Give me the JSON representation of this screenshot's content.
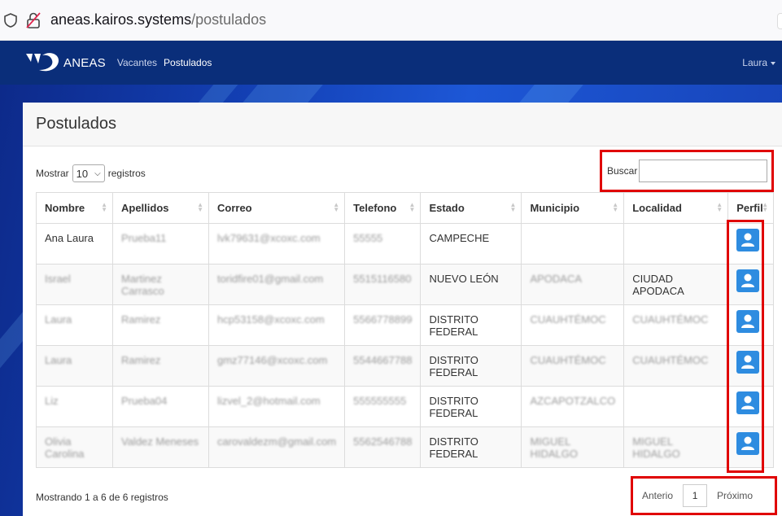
{
  "browser": {
    "url_host": "aneas.kairos.systems",
    "url_path": "/postulados"
  },
  "navbar": {
    "brand": "ANEAS",
    "links": [
      "Vacantes",
      "Postulados"
    ],
    "user": "Laura"
  },
  "card": {
    "title": "Postulados",
    "length_prefix": "Mostrar",
    "length_value": "10",
    "length_suffix": "registros",
    "search_label": "Buscar",
    "columns": [
      "Nombre",
      "Apellidos",
      "Correo",
      "Telefono",
      "Estado",
      "Municipio",
      "Localidad",
      "Perfil"
    ],
    "rows": [
      {
        "nombre": "Ana Laura",
        "apellidos": "Prueba11",
        "correo": "lvk79631@xcoxc.com",
        "telefono": "55555",
        "estado": "CAMPECHE",
        "municipio": "",
        "localidad": ""
      },
      {
        "nombre": "Israel",
        "apellidos": "Martinez Carrasco",
        "correo": "toridfire01@gmail.com",
        "telefono": "5515116580",
        "estado": "NUEVO LEÓN",
        "municipio": "APODACA",
        "localidad": "CIUDAD APODACA"
      },
      {
        "nombre": "Laura",
        "apellidos": "Ramirez",
        "correo": "hcp53158@xcoxc.com",
        "telefono": "5566778899",
        "estado": "DISTRITO FEDERAL",
        "municipio": "CUAUHTÉMOC",
        "localidad": "CUAUHTÉMOC"
      },
      {
        "nombre": "Laura",
        "apellidos": "Ramirez",
        "correo": "gmz77146@xcoxc.com",
        "telefono": "5544667788",
        "estado": "DISTRITO FEDERAL",
        "municipio": "CUAUHTÉMOC",
        "localidad": "CUAUHTÉMOC"
      },
      {
        "nombre": "Liz",
        "apellidos": "Prueba04",
        "correo": "lizvel_2@hotmail.com",
        "telefono": "555555555",
        "estado": "DISTRITO FEDERAL",
        "municipio": "AZCAPOTZALCO",
        "localidad": ""
      },
      {
        "nombre": "Olivia Carolina",
        "apellidos": "Valdez Meneses",
        "correo": "carovaldezm@gmail.com",
        "telefono": "5562546788",
        "estado": "DISTRITO FEDERAL",
        "municipio": "MIGUEL HIDALGO",
        "localidad": "MIGUEL HIDALGO"
      }
    ],
    "info": "Mostrando 1 a 6 de 6 registros",
    "pager": {
      "prev": "Anterio",
      "page": "1",
      "next": "Próximo"
    }
  },
  "colors": {
    "navbar": "#0a2e7a",
    "highlight": "#e00000",
    "perfil_button": "#2e8ce0"
  }
}
